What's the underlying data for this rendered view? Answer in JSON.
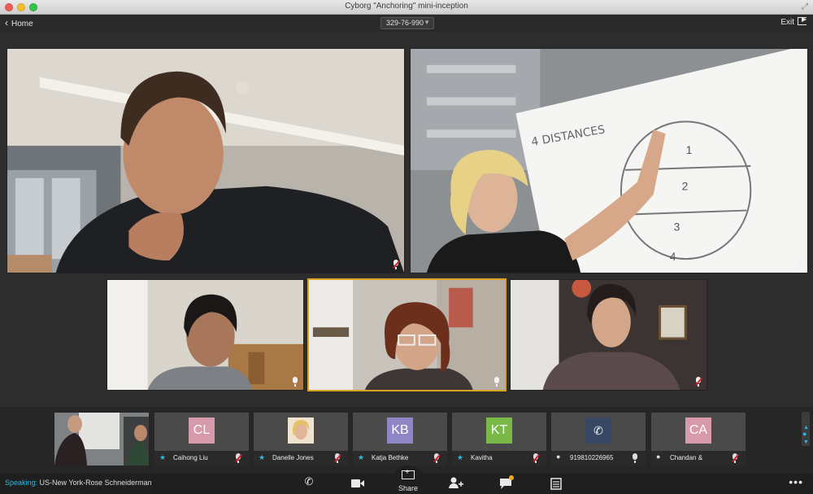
{
  "window": {
    "title": "Cyborg \"Anchoring\" mini-inception"
  },
  "toolbar": {
    "home_label": "Home",
    "meeting_id": "329-76-990",
    "exit_label": "Exit"
  },
  "participants": [
    {
      "name": "Caihong Liu",
      "initials": "CL",
      "avatar_color": "#d69aab",
      "kind": "star",
      "muted": true
    },
    {
      "name": "Danelle Jones",
      "initials": "",
      "avatar_color": "#d9b48a",
      "kind": "star",
      "muted": true
    },
    {
      "name": "Katja Bethke",
      "initials": "KB",
      "avatar_color": "#8f86c6",
      "kind": "star",
      "muted": true
    },
    {
      "name": "Kavitha",
      "initials": "KT",
      "avatar_color": "#7ab948",
      "kind": "star",
      "muted": true
    },
    {
      "name": "919810226965",
      "initials": "",
      "avatar_color": "#384763",
      "kind": "person",
      "muted": false
    },
    {
      "name": "Chandan &",
      "initials": "CA",
      "avatar_color": "#d69aab",
      "kind": "person",
      "muted": true
    }
  ],
  "status": {
    "speaking_label": "Speaking:",
    "speaking_name": "US-New York-Rose Schneiderman"
  },
  "bottom": {
    "share_label": "Share"
  },
  "icons": {
    "home": "chevron-left-icon",
    "exit": "exit-icon",
    "phone": "phone-icon",
    "video": "video-camera-icon",
    "share": "screen-share-icon",
    "add_participant": "add-person-icon",
    "chat": "chat-icon",
    "notes": "notes-icon",
    "more": "more-dots-icon"
  },
  "colors": {
    "accent": "#2fb9e0",
    "active_border": "#d9a421",
    "muted_red": "#d0212b"
  }
}
